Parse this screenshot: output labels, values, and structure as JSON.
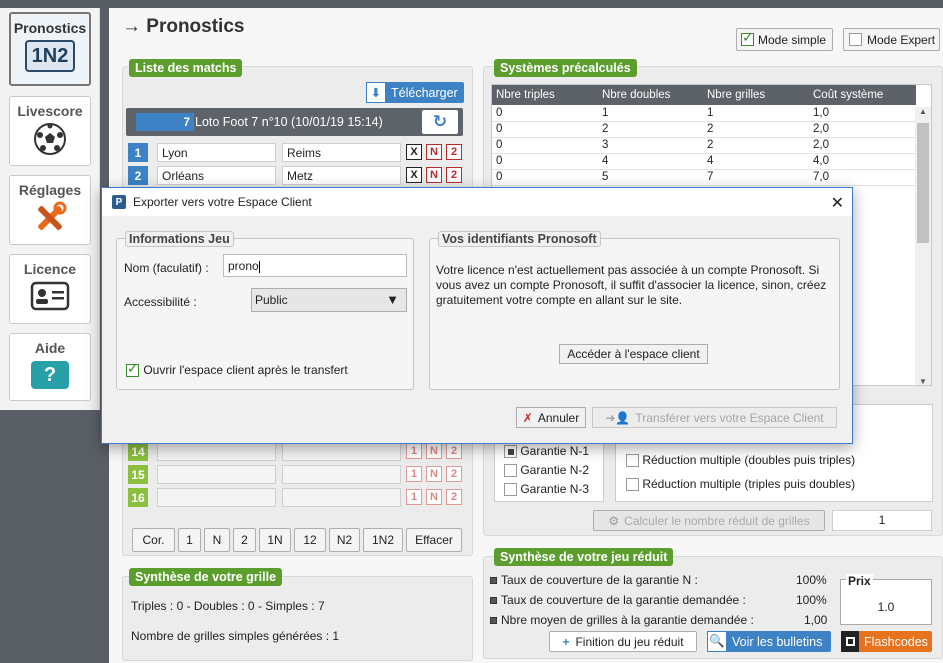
{
  "page": {
    "title": "Pronostics",
    "arrow": "→"
  },
  "nav": {
    "pronostics": {
      "label": "Pronostics",
      "sub": "1N2"
    },
    "livescore": {
      "label": "Livescore"
    },
    "reglages": {
      "label": "Réglages"
    },
    "licence": {
      "label": "Licence"
    },
    "aide": {
      "label": "Aide",
      "glyph": "?"
    }
  },
  "mode": {
    "simple": "Mode simple",
    "expert": "Mode Expert"
  },
  "matches": {
    "tag": "Liste des matchs",
    "download": "Télécharger",
    "grid_number": "7",
    "grid_title": "Loto Foot 7 n°10 (10/01/19 15:14)",
    "rows": [
      {
        "n": "1",
        "home": "Lyon",
        "away": "Reims"
      },
      {
        "n": "2",
        "home": "Orléans",
        "away": "Metz"
      }
    ],
    "empty_rows": [
      "14",
      "15",
      "16"
    ],
    "opts": [
      "X",
      "N",
      "2"
    ],
    "opts_lower": [
      "1",
      "N",
      "2"
    ],
    "footer_buttons": [
      "Cor.",
      "1",
      "N",
      "2",
      "1N",
      "12",
      "N2",
      "1N2",
      "Effacer"
    ]
  },
  "grille": {
    "tag": "Synthèse de votre grille",
    "line1": "Triples : 0 - Doubles : 0 - Simples : 7",
    "line2": "Nombre de grilles simples générées : 1"
  },
  "systems": {
    "tag": "Systèmes précalculés",
    "headers": [
      "Nbre triples",
      "Nbre doubles",
      "Nbre grilles",
      "Coût système"
    ],
    "rows": [
      [
        "0",
        "1",
        "1",
        "1,0"
      ],
      [
        "0",
        "2",
        "2",
        "2,0"
      ],
      [
        "0",
        "3",
        "2",
        "2,0"
      ],
      [
        "0",
        "4",
        "4",
        "4,0"
      ],
      [
        "0",
        "5",
        "7",
        "7,0"
      ]
    ]
  },
  "garanties": {
    "items": [
      "Garantie N-1",
      "Garantie N-2",
      "Garantie N-3"
    ],
    "reductions": [
      "Réduction multiple (doubles puis triples)",
      "Réduction multiple (triples puis doubles)"
    ],
    "calc_button": "Calculer le nombre réduit de grilles",
    "calc_value": "1"
  },
  "reduit": {
    "tag": "Synthèse de votre jeu réduit",
    "lines": [
      {
        "label": "Taux de couverture de la garantie N :",
        "value": "100%"
      },
      {
        "label": "Taux de couverture de la garantie demandée :",
        "value": "100%"
      },
      {
        "label": "Nbre moyen de grilles à la garantie demandée :",
        "value": "1,00"
      }
    ],
    "prix_label": "Prix",
    "prix_value": "1.0",
    "finition": "Finition du jeu réduit",
    "bulletins": "Voir les bulletins",
    "flashcodes": "Flashcodes"
  },
  "dialog": {
    "title": "Exporter vers votre Espace Client",
    "info_group": "Informations Jeu",
    "name_label": "Nom (faculatif) :",
    "name_value": "prono",
    "access_label": "Accessibilité :",
    "access_value": "Public",
    "open_label": "Ouvrir l'espace client après le transfert",
    "ids_group": "Vos identifiants Pronosoft",
    "message": "Votre licence n'est actuellement pas associée à un compte Pronosoft. Si vous avez un compte Pronosoft, il suffit d'associer la licence, sinon, créez gratuitement votre compte en allant sur le site.",
    "access_button": "Accéder à l'espace client",
    "cancel": "Annuler",
    "transfer": "Transférer vers votre Espace Client"
  },
  "colors": {
    "green": "#5b9e2e",
    "blue": "#3c82c4",
    "orange": "#e8731e",
    "red": "#b72b2b"
  }
}
